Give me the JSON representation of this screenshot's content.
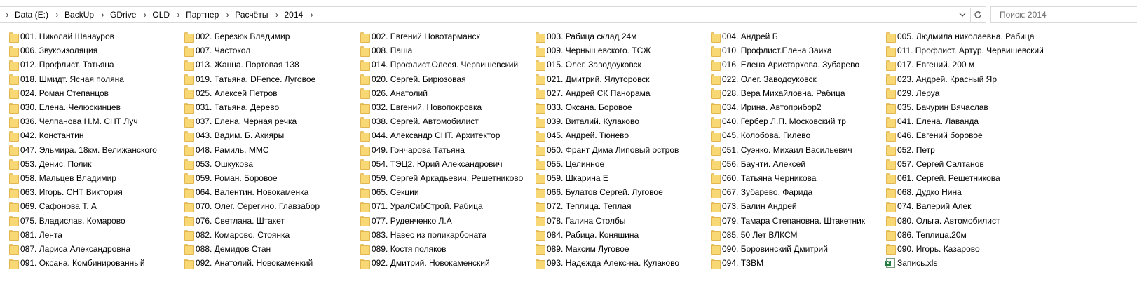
{
  "address_bar": {
    "path": [
      "Data (E:)",
      "BackUp",
      "GDrive",
      "OLD",
      "Партнер",
      "Расчёты",
      "2014"
    ],
    "dropdown_icon": "chevron-down-icon",
    "refresh_icon": "refresh-icon"
  },
  "search": {
    "placeholder": "Поиск: 2014"
  },
  "columns": [
    [
      {
        "name": "001. Николай Шанауров",
        "type": "folder"
      },
      {
        "name": "006. Звукоизоляция",
        "type": "folder"
      },
      {
        "name": "012. Профлист. Татьяна",
        "type": "folder"
      },
      {
        "name": "018. Шмидт. Ясная поляна",
        "type": "folder"
      },
      {
        "name": "024. Роман Степанцов",
        "type": "folder"
      },
      {
        "name": "030. Елена. Челюскинцев",
        "type": "folder"
      },
      {
        "name": "036. Челпанова Н.М. СНТ Луч",
        "type": "folder"
      },
      {
        "name": "042. Константин",
        "type": "folder"
      },
      {
        "name": "047. Эльмира. 18км. Велижанского",
        "type": "folder"
      },
      {
        "name": "053. Денис. Полик",
        "type": "folder"
      },
      {
        "name": "058. Мальцев Владимир",
        "type": "folder"
      },
      {
        "name": "063. Игорь. СНТ Виктория",
        "type": "folder"
      },
      {
        "name": "069. Сафонова Т. А",
        "type": "folder"
      },
      {
        "name": "075. Владислав. Комарово",
        "type": "folder"
      },
      {
        "name": "081. Лента",
        "type": "folder"
      },
      {
        "name": "087. Лариса Александровна",
        "type": "folder"
      },
      {
        "name": "091. Оксана. Комбинированный",
        "type": "folder"
      }
    ],
    [
      {
        "name": "002. Березюк Владимир",
        "type": "folder"
      },
      {
        "name": "007. Частокол",
        "type": "folder"
      },
      {
        "name": "013. Жанна. Портовая 138",
        "type": "folder"
      },
      {
        "name": "019. Татьяна. DFence. Луговое",
        "type": "folder"
      },
      {
        "name": "025. Алексей Петров",
        "type": "folder"
      },
      {
        "name": "031. Татьяна. Дерево",
        "type": "folder"
      },
      {
        "name": "037. Елена. Черная речка",
        "type": "folder"
      },
      {
        "name": "043. Вадим. Б. Акияры",
        "type": "folder"
      },
      {
        "name": "048. Рамиль. ММС",
        "type": "folder"
      },
      {
        "name": "053. Ошкукова",
        "type": "folder"
      },
      {
        "name": "059. Роман. Боровое",
        "type": "folder"
      },
      {
        "name": "064. Валентин. Новокаменка",
        "type": "folder"
      },
      {
        "name": "070. Олег. Серегино. Главзабор",
        "type": "folder"
      },
      {
        "name": "076. Светлана. Штакет",
        "type": "folder"
      },
      {
        "name": "082. Комарово. Стоянка",
        "type": "folder"
      },
      {
        "name": "088. Демидов Стан",
        "type": "folder"
      },
      {
        "name": "092. Анатолий. Новокаменкий",
        "type": "folder"
      }
    ],
    [
      {
        "name": "002. Евгений Новотарманск",
        "type": "folder"
      },
      {
        "name": "008. Паша",
        "type": "folder"
      },
      {
        "name": "014. Профлист.Олеся. Червишевский",
        "type": "folder"
      },
      {
        "name": "020. Сергей. Бирюзовая",
        "type": "folder"
      },
      {
        "name": "026. Анатолий",
        "type": "folder"
      },
      {
        "name": "032. Евгений. Новопокровка",
        "type": "folder"
      },
      {
        "name": "038. Сергей. Автомобилист",
        "type": "folder"
      },
      {
        "name": "044. Александр СНТ. Архитектор",
        "type": "folder"
      },
      {
        "name": "049. Гончарова Татьяна",
        "type": "folder"
      },
      {
        "name": "054. ТЭЦ2. Юрий Александрович",
        "type": "folder"
      },
      {
        "name": "059. Сергей Аркадьевич. Решетниково",
        "type": "folder"
      },
      {
        "name": "065. Секции",
        "type": "folder"
      },
      {
        "name": "071. УралСибСтрой. Рабица",
        "type": "folder"
      },
      {
        "name": "077. Руденченко Л.А",
        "type": "folder"
      },
      {
        "name": "083. Навес из поликарбоната",
        "type": "folder"
      },
      {
        "name": "089. Костя поляков",
        "type": "folder"
      },
      {
        "name": "092. Дмитрий. Новокаменский",
        "type": "folder"
      }
    ],
    [
      {
        "name": "003. Рабица склад 24м",
        "type": "folder"
      },
      {
        "name": "009. Чернышевского. ТСЖ",
        "type": "folder"
      },
      {
        "name": "015. Олег. Заводоуковск",
        "type": "folder"
      },
      {
        "name": "021. Дмитрий. Ялуторовск",
        "type": "folder"
      },
      {
        "name": "027. Андрей СК Панорама",
        "type": "folder"
      },
      {
        "name": "033. Оксана. Боровое",
        "type": "folder"
      },
      {
        "name": "039. Виталий. Кулаково",
        "type": "folder"
      },
      {
        "name": "045. Андрей. Тюнево",
        "type": "folder"
      },
      {
        "name": "050. Франт Дима Липовый остров",
        "type": "folder"
      },
      {
        "name": "055. Целинное",
        "type": "folder"
      },
      {
        "name": "059. Шкарина Е",
        "type": "folder"
      },
      {
        "name": "066. Булатов Сергей. Луговое",
        "type": "folder"
      },
      {
        "name": "072. Теплица. Теплая",
        "type": "folder"
      },
      {
        "name": "078. Галина Столбы",
        "type": "folder"
      },
      {
        "name": "084. Рабица. Коняшина",
        "type": "folder"
      },
      {
        "name": "089. Максим Луговое",
        "type": "folder"
      },
      {
        "name": "093. Надежда Алекс-на. Кулаково",
        "type": "folder"
      }
    ],
    [
      {
        "name": "004. Андрей Б",
        "type": "folder"
      },
      {
        "name": "010. Профлист.Елена Заика",
        "type": "folder"
      },
      {
        "name": "016. Елена Аристархова. Зубарево",
        "type": "folder"
      },
      {
        "name": "022. Олег. Заводоуковск",
        "type": "folder"
      },
      {
        "name": "028. Вера Михайловна. Рабица",
        "type": "folder"
      },
      {
        "name": "034. Ирина. Автоприбор2",
        "type": "folder"
      },
      {
        "name": "040. Гербер Л.П. Московский тр",
        "type": "folder"
      },
      {
        "name": "045. Колобова. Гилево",
        "type": "folder"
      },
      {
        "name": "051. Суэнко. Михаил Васильевич",
        "type": "folder"
      },
      {
        "name": "056. Баунти. Алексей",
        "type": "folder"
      },
      {
        "name": "060. Татьяна Черникова",
        "type": "folder"
      },
      {
        "name": "067. Зубарево. Фарида",
        "type": "folder"
      },
      {
        "name": "073. Балин Андрей",
        "type": "folder"
      },
      {
        "name": "079. Тамара Степановна. Штакетник",
        "type": "folder"
      },
      {
        "name": "085. 50 Лет ВЛКСМ",
        "type": "folder"
      },
      {
        "name": "090. Боровинский Дмитрий",
        "type": "folder"
      },
      {
        "name": "094. ТЗВМ",
        "type": "folder"
      }
    ],
    [
      {
        "name": "005. Людмила николаевна. Рабица",
        "type": "folder"
      },
      {
        "name": "011. Профлист. Артур. Червишевский",
        "type": "folder"
      },
      {
        "name": "017. Евгений. 200 м",
        "type": "folder"
      },
      {
        "name": "023. Андрей. Красный Яр",
        "type": "folder"
      },
      {
        "name": "029. Леруа",
        "type": "folder"
      },
      {
        "name": "035. Бачурин Вячаслав",
        "type": "folder"
      },
      {
        "name": "041. Елена. Лаванда",
        "type": "folder"
      },
      {
        "name": "046. Евгений боровое",
        "type": "folder"
      },
      {
        "name": "052. Петр",
        "type": "folder"
      },
      {
        "name": "057. Сергей Салтанов",
        "type": "folder"
      },
      {
        "name": "061. Сергей. Решетникова",
        "type": "folder"
      },
      {
        "name": "068. Дудко Нина",
        "type": "folder"
      },
      {
        "name": "074. Валерий Алек",
        "type": "folder"
      },
      {
        "name": "080. Ольга. Автомобилист",
        "type": "folder"
      },
      {
        "name": "086. Теплица.20м",
        "type": "folder"
      },
      {
        "name": "090. Игорь. Казарово",
        "type": "folder"
      },
      {
        "name": "Запись.xls",
        "type": "xls"
      }
    ]
  ]
}
